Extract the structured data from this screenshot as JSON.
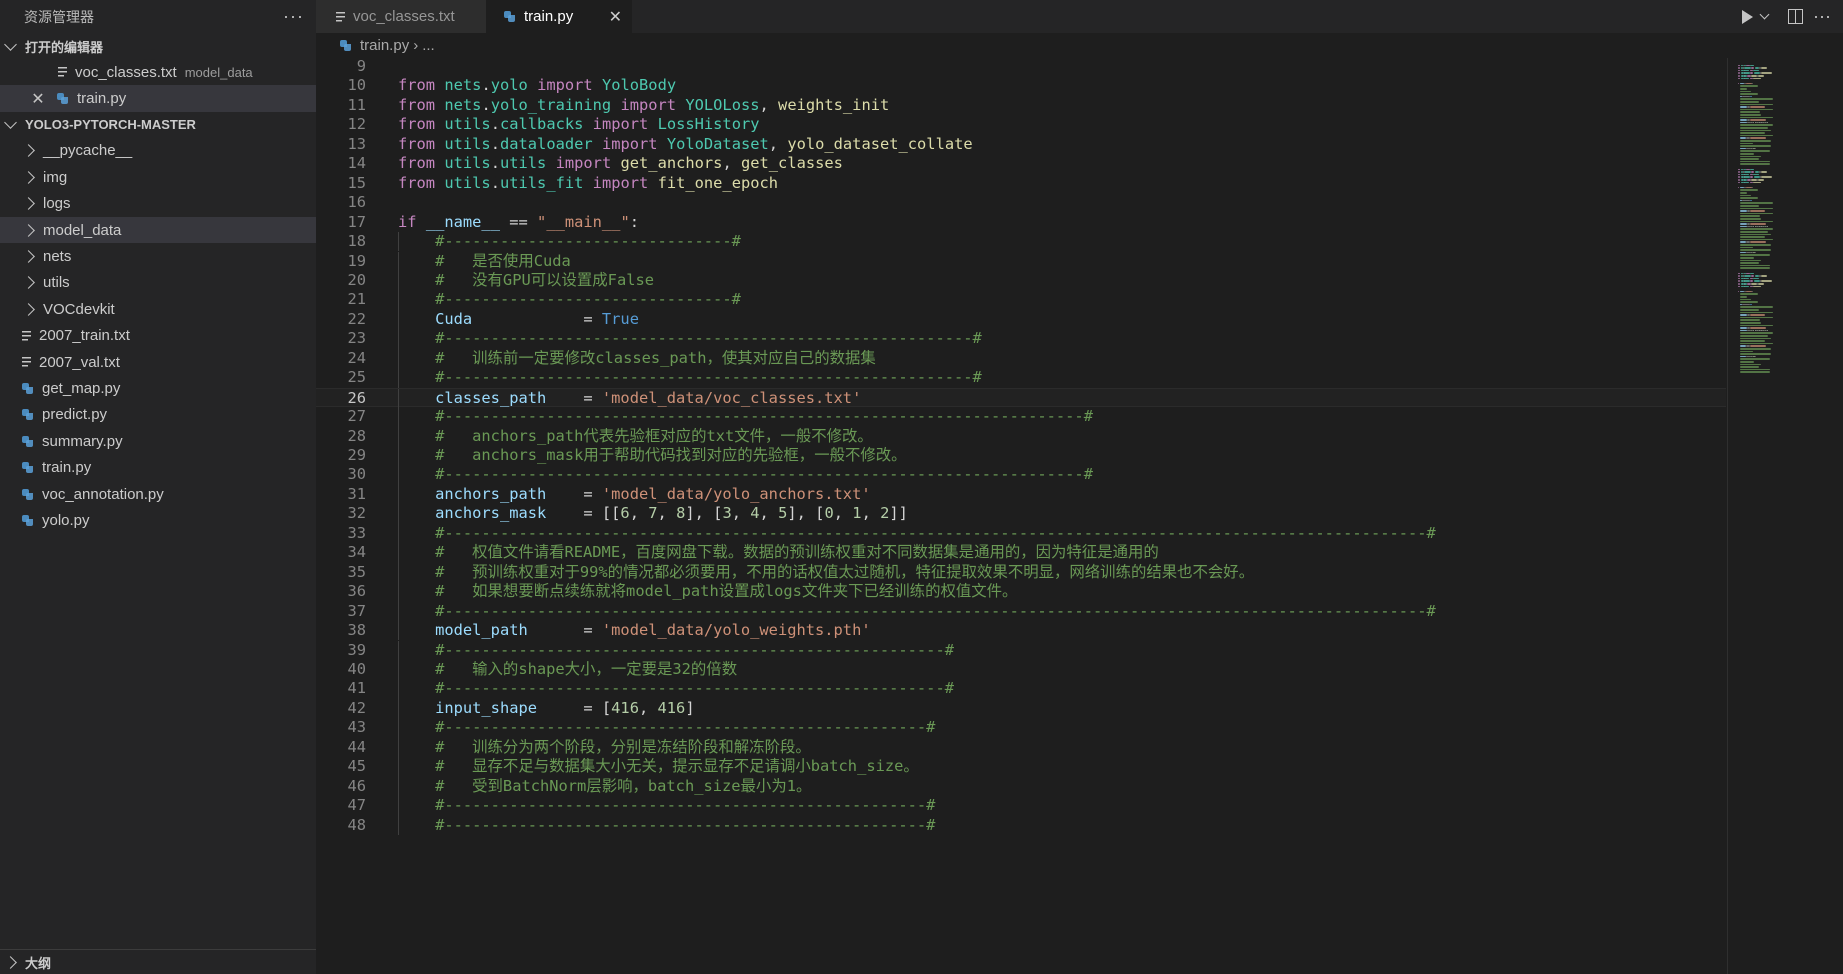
{
  "sidebar": {
    "title": "资源管理器",
    "more_label": "···",
    "open_editors": {
      "title": "打开的编辑器",
      "items": [
        {
          "name": "voc_classes.txt",
          "desc": "model_data"
        },
        {
          "name": "train.py",
          "desc": ""
        }
      ]
    },
    "project": {
      "title": "YOLO3-PYTORCH-MASTER",
      "folders": [
        "__pycache__",
        "img",
        "logs",
        "model_data",
        "nets",
        "utils",
        "VOCdevkit"
      ],
      "files": [
        "2007_train.txt",
        "2007_val.txt",
        "get_map.py",
        "predict.py",
        "summary.py",
        "train.py",
        "voc_annotation.py",
        "yolo.py"
      ]
    },
    "outline_title": "大纲"
  },
  "tabs": [
    {
      "label": "voc_classes.txt"
    },
    {
      "label": "train.py",
      "close": "✕"
    }
  ],
  "breadcrumb": {
    "file": "train.py",
    "sep": "›",
    "rest": "..."
  },
  "colors": {
    "accent": "#007acc",
    "background": "#1e1e1e",
    "sidebar": "#252526",
    "keyword": "#c586c0",
    "comment": "#6a9955",
    "string": "#ce9178",
    "variable": "#9cdcfe"
  },
  "editor": {
    "active_line": 26,
    "lines": [
      {
        "n": 9,
        "tokens": []
      },
      {
        "n": 10,
        "tokens": [
          [
            "kw",
            "from"
          ],
          [
            "plain",
            " "
          ],
          [
            "cls",
            "nets"
          ],
          [
            "plain",
            "."
          ],
          [
            "cls",
            "yolo"
          ],
          [
            "plain",
            " "
          ],
          [
            "kw",
            "import"
          ],
          [
            "plain",
            " "
          ],
          [
            "cls",
            "YoloBody"
          ]
        ]
      },
      {
        "n": 11,
        "tokens": [
          [
            "kw",
            "from"
          ],
          [
            "plain",
            " "
          ],
          [
            "cls",
            "nets"
          ],
          [
            "plain",
            "."
          ],
          [
            "cls",
            "yolo_training"
          ],
          [
            "plain",
            " "
          ],
          [
            "kw",
            "import"
          ],
          [
            "plain",
            " "
          ],
          [
            "cls",
            "YOLOLoss"
          ],
          [
            "plain",
            ", "
          ],
          [
            "fn",
            "weights_init"
          ]
        ]
      },
      {
        "n": 12,
        "tokens": [
          [
            "kw",
            "from"
          ],
          [
            "plain",
            " "
          ],
          [
            "cls",
            "utils"
          ],
          [
            "plain",
            "."
          ],
          [
            "cls",
            "callbacks"
          ],
          [
            "plain",
            " "
          ],
          [
            "kw",
            "import"
          ],
          [
            "plain",
            " "
          ],
          [
            "cls",
            "LossHistory"
          ]
        ]
      },
      {
        "n": 13,
        "tokens": [
          [
            "kw",
            "from"
          ],
          [
            "plain",
            " "
          ],
          [
            "cls",
            "utils"
          ],
          [
            "plain",
            "."
          ],
          [
            "cls",
            "dataloader"
          ],
          [
            "plain",
            " "
          ],
          [
            "kw",
            "import"
          ],
          [
            "plain",
            " "
          ],
          [
            "cls",
            "YoloDataset"
          ],
          [
            "plain",
            ", "
          ],
          [
            "fn",
            "yolo_dataset_collate"
          ]
        ]
      },
      {
        "n": 14,
        "tokens": [
          [
            "kw",
            "from"
          ],
          [
            "plain",
            " "
          ],
          [
            "cls",
            "utils"
          ],
          [
            "plain",
            "."
          ],
          [
            "cls",
            "utils"
          ],
          [
            "plain",
            " "
          ],
          [
            "kw",
            "import"
          ],
          [
            "plain",
            " "
          ],
          [
            "fn",
            "get_anchors"
          ],
          [
            "plain",
            ", "
          ],
          [
            "fn",
            "get_classes"
          ]
        ]
      },
      {
        "n": 15,
        "tokens": [
          [
            "kw",
            "from"
          ],
          [
            "plain",
            " "
          ],
          [
            "cls",
            "utils"
          ],
          [
            "plain",
            "."
          ],
          [
            "cls",
            "utils_fit"
          ],
          [
            "plain",
            " "
          ],
          [
            "kw",
            "import"
          ],
          [
            "plain",
            " "
          ],
          [
            "fn",
            "fit_one_epoch"
          ]
        ]
      },
      {
        "n": 16,
        "tokens": []
      },
      {
        "n": 17,
        "tokens": [
          [
            "ctl",
            "if"
          ],
          [
            "plain",
            " "
          ],
          [
            "var",
            "__name__"
          ],
          [
            "plain",
            " == "
          ],
          [
            "str",
            "\"__main__\""
          ],
          [
            "plain",
            ":"
          ]
        ]
      },
      {
        "n": 18,
        "tokens": [
          [
            "plain",
            "    "
          ],
          [
            "cmt",
            "#-------------------------------#"
          ]
        ]
      },
      {
        "n": 19,
        "tokens": [
          [
            "plain",
            "    "
          ],
          [
            "cmt",
            "#   是否使用Cuda"
          ]
        ]
      },
      {
        "n": 20,
        "tokens": [
          [
            "plain",
            "    "
          ],
          [
            "cmt",
            "#   没有GPU可以设置成False"
          ]
        ]
      },
      {
        "n": 21,
        "tokens": [
          [
            "plain",
            "    "
          ],
          [
            "cmt",
            "#-------------------------------#"
          ]
        ]
      },
      {
        "n": 22,
        "tokens": [
          [
            "plain",
            "    "
          ],
          [
            "var",
            "Cuda"
          ],
          [
            "plain",
            "            = "
          ],
          [
            "bool",
            "True"
          ]
        ]
      },
      {
        "n": 23,
        "tokens": [
          [
            "plain",
            "    "
          ],
          [
            "cmt",
            "#---------------------------------------------------------#"
          ]
        ]
      },
      {
        "n": 24,
        "tokens": [
          [
            "plain",
            "    "
          ],
          [
            "cmt",
            "#   训练前一定要修改classes_path，使其对应自己的数据集"
          ]
        ]
      },
      {
        "n": 25,
        "tokens": [
          [
            "plain",
            "    "
          ],
          [
            "cmt",
            "#---------------------------------------------------------#"
          ]
        ]
      },
      {
        "n": 26,
        "tokens": [
          [
            "plain",
            "    "
          ],
          [
            "var",
            "classes_path"
          ],
          [
            "plain",
            "    = "
          ],
          [
            "str",
            "'model_data/voc_classes.txt'"
          ]
        ]
      },
      {
        "n": 27,
        "tokens": [
          [
            "plain",
            "    "
          ],
          [
            "cmt",
            "#---------------------------------------------------------------------#"
          ]
        ]
      },
      {
        "n": 28,
        "tokens": [
          [
            "plain",
            "    "
          ],
          [
            "cmt",
            "#   anchors_path代表先验框对应的txt文件，一般不修改。"
          ]
        ]
      },
      {
        "n": 29,
        "tokens": [
          [
            "plain",
            "    "
          ],
          [
            "cmt",
            "#   anchors_mask用于帮助代码找到对应的先验框，一般不修改。"
          ]
        ]
      },
      {
        "n": 30,
        "tokens": [
          [
            "plain",
            "    "
          ],
          [
            "cmt",
            "#---------------------------------------------------------------------#"
          ]
        ]
      },
      {
        "n": 31,
        "tokens": [
          [
            "plain",
            "    "
          ],
          [
            "var",
            "anchors_path"
          ],
          [
            "plain",
            "    = "
          ],
          [
            "str",
            "'model_data/yolo_anchors.txt'"
          ]
        ]
      },
      {
        "n": 32,
        "tokens": [
          [
            "plain",
            "    "
          ],
          [
            "var",
            "anchors_mask"
          ],
          [
            "plain",
            "    = [["
          ],
          [
            "num",
            "6"
          ],
          [
            "plain",
            ", "
          ],
          [
            "num",
            "7"
          ],
          [
            "plain",
            ", "
          ],
          [
            "num",
            "8"
          ],
          [
            "plain",
            "], ["
          ],
          [
            "num",
            "3"
          ],
          [
            "plain",
            ", "
          ],
          [
            "num",
            "4"
          ],
          [
            "plain",
            ", "
          ],
          [
            "num",
            "5"
          ],
          [
            "plain",
            "], ["
          ],
          [
            "num",
            "0"
          ],
          [
            "plain",
            ", "
          ],
          [
            "num",
            "1"
          ],
          [
            "plain",
            ", "
          ],
          [
            "num",
            "2"
          ],
          [
            "plain",
            "]]"
          ]
        ]
      },
      {
        "n": 33,
        "tokens": [
          [
            "plain",
            "    "
          ],
          [
            "cmt",
            "#----------------------------------------------------------------------------------------------------------#"
          ]
        ]
      },
      {
        "n": 34,
        "tokens": [
          [
            "plain",
            "    "
          ],
          [
            "cmt",
            "#   权值文件请看README，百度网盘下载。数据的预训练权重对不同数据集是通用的，因为特征是通用的"
          ]
        ]
      },
      {
        "n": 35,
        "tokens": [
          [
            "plain",
            "    "
          ],
          [
            "cmt",
            "#   预训练权重对于99%的情况都必须要用，不用的话权值太过随机，特征提取效果不明显，网络训练的结果也不会好。"
          ]
        ]
      },
      {
        "n": 36,
        "tokens": [
          [
            "plain",
            "    "
          ],
          [
            "cmt",
            "#   如果想要断点续练就将model_path设置成logs文件夹下已经训练的权值文件。"
          ]
        ]
      },
      {
        "n": 37,
        "tokens": [
          [
            "plain",
            "    "
          ],
          [
            "cmt",
            "#----------------------------------------------------------------------------------------------------------#"
          ]
        ]
      },
      {
        "n": 38,
        "tokens": [
          [
            "plain",
            "    "
          ],
          [
            "var",
            "model_path"
          ],
          [
            "plain",
            "      = "
          ],
          [
            "str",
            "'model_data/yolo_weights.pth'"
          ]
        ]
      },
      {
        "n": 39,
        "tokens": [
          [
            "plain",
            "    "
          ],
          [
            "cmt",
            "#------------------------------------------------------#"
          ]
        ]
      },
      {
        "n": 40,
        "tokens": [
          [
            "plain",
            "    "
          ],
          [
            "cmt",
            "#   输入的shape大小，一定要是32的倍数"
          ]
        ]
      },
      {
        "n": 41,
        "tokens": [
          [
            "plain",
            "    "
          ],
          [
            "cmt",
            "#------------------------------------------------------#"
          ]
        ]
      },
      {
        "n": 42,
        "tokens": [
          [
            "plain",
            "    "
          ],
          [
            "var",
            "input_shape"
          ],
          [
            "plain",
            "     = ["
          ],
          [
            "num",
            "416"
          ],
          [
            "plain",
            ", "
          ],
          [
            "num",
            "416"
          ],
          [
            "plain",
            "]"
          ]
        ]
      },
      {
        "n": 43,
        "tokens": [
          [
            "plain",
            "    "
          ],
          [
            "cmt",
            "#----------------------------------------------------#"
          ]
        ]
      },
      {
        "n": 44,
        "tokens": [
          [
            "plain",
            "    "
          ],
          [
            "cmt",
            "#   训练分为两个阶段，分别是冻结阶段和解冻阶段。"
          ]
        ]
      },
      {
        "n": 45,
        "tokens": [
          [
            "plain",
            "    "
          ],
          [
            "cmt",
            "#   显存不足与数据集大小无关，提示显存不足请调小batch_size。"
          ]
        ]
      },
      {
        "n": 46,
        "tokens": [
          [
            "plain",
            "    "
          ],
          [
            "cmt",
            "#   受到BatchNorm层影响，batch_size最小为1。"
          ]
        ]
      },
      {
        "n": 47,
        "tokens": [
          [
            "plain",
            "    "
          ],
          [
            "cmt",
            "#----------------------------------------------------#"
          ]
        ]
      },
      {
        "n": 48,
        "tokens": [
          [
            "plain",
            "    "
          ],
          [
            "cmt",
            "#----------------------------------------------------#"
          ]
        ]
      }
    ]
  }
}
